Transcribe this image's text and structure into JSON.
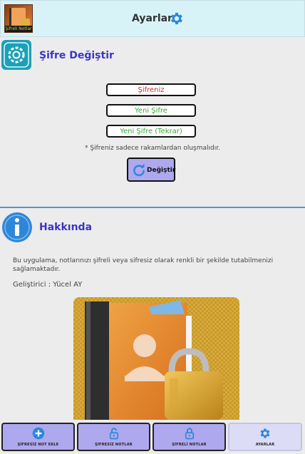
{
  "header": {
    "logo_caption": "Şifreli Notlar",
    "title": "Ayarlar",
    "settings_icon": "gear-icon"
  },
  "password_section": {
    "title": "Şifre Değiştir",
    "icon": "settings-app-icon",
    "current_placeholder": "Şifreniz",
    "new_placeholder": "Yeni Şifre",
    "confirm_placeholder": "Yeni Şifre (Tekrar)",
    "note": "* Şifreniz sadece rakamlardan oluşmalıdır.",
    "change_button": "Değiştir",
    "change_icon": "refresh-icon"
  },
  "about_section": {
    "title": "Hakkında",
    "icon": "info-icon",
    "description": "Bu uygulama, notlarınızı şifreli veya sifresiz olarak renkli bir şekilde tutabilmenizi sağlamaktadır.",
    "developer": "Geliştirici : Yücel AY"
  },
  "bottom_nav": {
    "items": [
      {
        "label": "ŞİFRESİZ NOT EKLE",
        "icon": "plus-circle-icon",
        "active": false
      },
      {
        "label": "ŞİFRESİZ NOTLAR",
        "icon": "unlock-icon",
        "active": false
      },
      {
        "label": "ŞİFRELİ NOTLAR",
        "icon": "lock-icon",
        "active": false
      },
      {
        "label": "AYARLAR",
        "icon": "gear-icon",
        "active": true
      }
    ]
  },
  "colors": {
    "header_bg": "#d8f3f8",
    "accent_title": "#3a36c4",
    "button_bg": "#aea8ee",
    "divider": "#5b8fd6",
    "icon_blue": "#2d87d9"
  }
}
